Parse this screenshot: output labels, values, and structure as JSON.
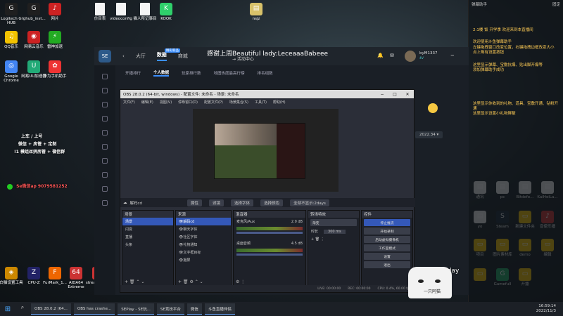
{
  "desktop": {
    "icons_left": [
      {
        "label": "Logitech G HUB",
        "color": "#1f1f1f",
        "glyph": "G"
      },
      {
        "label": "lghub_inst...",
        "color": "#1f1f1f",
        "glyph": "G"
      },
      {
        "label": "网片",
        "color": "#c22",
        "glyph": "♪"
      },
      {
        "label": "QQ音乐",
        "color": "#f2c200",
        "glyph": "♫"
      },
      {
        "label": "网易云音乐",
        "color": "#c22",
        "glyph": "◉"
      },
      {
        "label": "雷神加速",
        "color": "#2a2",
        "glyph": "⚡"
      },
      {
        "label": "Google Chrome",
        "color": "#4285f4",
        "glyph": "◎"
      },
      {
        "label": "网易UU加速器",
        "color": "#2a7",
        "glyph": "U"
      },
      {
        "label": "华为手机助手",
        "color": "#e33",
        "glyph": "✿"
      }
    ],
    "icons_top_files": [
      {
        "label": "价目表"
      },
      {
        "label": "videoconfig"
      },
      {
        "label": "猫人所记事目"
      }
    ],
    "icons_top_apps": [
      {
        "label": "KOOK",
        "color": "#2fd06b",
        "glyph": "K"
      },
      {
        "label": "nsjz",
        "color": "#d8c26a",
        "glyph": "▤"
      }
    ],
    "icons_bottom": [
      {
        "label": "白猫设置工具",
        "color": "#c80",
        "glyph": "◈"
      },
      {
        "label": "CPU-Z",
        "color": "#226",
        "glyph": "Z"
      },
      {
        "label": "FurMark_1...",
        "color": "#e60",
        "glyph": "F"
      },
      {
        "label": "AIDA64 Extreme",
        "color": "#c33",
        "glyph": "64"
      },
      {
        "label": "streamcom...",
        "color": "#c33",
        "glyph": "◆"
      }
    ],
    "icons_right": [
      {
        "label": "通讯",
        "color": "#eee",
        "glyph": "▤"
      },
      {
        "label": "pc",
        "color": "#eee",
        "glyph": "▤"
      },
      {
        "label": "Bitdefe...",
        "color": "#eee",
        "glyph": "▤"
      },
      {
        "label": "KaiHeiLa...",
        "color": "#eee",
        "glyph": "▤"
      },
      {
        "label": "yo",
        "color": "#eee",
        "glyph": "▤"
      },
      {
        "label": "Steam",
        "color": "#1b2838",
        "glyph": "S"
      },
      {
        "label": "新建文件夹",
        "color": "#f2c200",
        "glyph": "▭"
      },
      {
        "label": "音使乐播",
        "color": "#c33",
        "glyph": "♪"
      },
      {
        "label": "项目",
        "color": "#f2c200",
        "glyph": "▭"
      },
      {
        "label": "图片素材库",
        "color": "#f2c200",
        "glyph": "▭"
      },
      {
        "label": "demo",
        "color": "#f2c200",
        "glyph": "▭"
      },
      {
        "label": "编辑",
        "color": "#f2c200",
        "glyph": "▭"
      },
      {
        "label": "",
        "color": "#f2c200",
        "glyph": "▭"
      },
      {
        "label": "Gamefull",
        "color": "#2a6",
        "glyph": "G"
      },
      {
        "label": "开播",
        "color": "#f2c200",
        "glyph": "▭"
      }
    ]
  },
  "overlay": {
    "line1": "上车 / 上号",
    "line2": "微信 + 房管 + 定制",
    "line3": "!1 模组丝拼房管 + 微信群",
    "wechat": "Se微信ap 9079581252",
    "bottom_text": "坚毅不屈 ·day",
    "cat_text": "一只阿猫"
  },
  "site": {
    "logo": "SE",
    "nav": [
      "大厅",
      "数据",
      "商城"
    ],
    "nav_badge": "精彩新品",
    "ticker": "感谢上周Beautiful lady:LeceaaaBabeee",
    "ticker_prefix": "→ 活动中心",
    "subnav": [
      "开播排行",
      "个人数据",
      "玩家排行数",
      "地图热度最高行榜",
      "排名组数"
    ],
    "user_name": "byM1337",
    "user_level": "4V",
    "date_select": "2022.34"
  },
  "obs": {
    "title": "OBS 28.0.2 (64-bit, windows) - 配置文件: 未命名 - 场景: 未命名",
    "menu": [
      "文件(F)",
      "编辑(E)",
      "视图(V)",
      "停靠窗口(D)",
      "配置文件(P)",
      "场景集合(S)",
      "工具(T)",
      "帮助(H)"
    ],
    "source_label": "解码cd",
    "source_buttons": [
      "属性",
      "滤镜",
      "选择字体",
      "选择颜色",
      "全部不显示:2days"
    ],
    "docks": {
      "scenes": {
        "title": "场景",
        "items": [
          "场景",
          "闪变",
          "直播",
          "头条"
        ]
      },
      "sources": {
        "title": "来源",
        "items": [
          "解码cd",
          "聊天字体",
          "社区字体",
          "礼物通知",
          "文字框目标",
          "摄屏"
        ]
      },
      "mixer": {
        "title": "混音器",
        "tracks": [
          {
            "name": "麦克风/Aux",
            "db": "2.0 dB"
          },
          {
            "name": "桌面音频",
            "db": "4.5 dB"
          }
        ]
      },
      "transitions": {
        "title": "转场特效",
        "type": "渐变",
        "duration_label": "时长",
        "duration": "300 ms"
      },
      "controls": {
        "title": "控件",
        "buttons": [
          "停止推流",
          "开始录制",
          "启动虚拟摄像机",
          "工作室模式",
          "设置",
          "退出"
        ]
      }
    },
    "status": {
      "live": "LIVE: 00:00:00",
      "rec": "REC: 00:00:00",
      "cpu": "CPU: 0.4%, 60.00 fps"
    }
  },
  "chat": {
    "header_left": "弹幕助手",
    "header_right": "固定",
    "messages": [
      {
        "text": "2:1楼 饭 开学季 欢迎来到本直播间",
        "color": "yellow"
      },
      {
        "text": "欢迎使用斗鱼弹幕助手",
        "color": "yellow"
      },
      {
        "text": "左键拖拽窗口改变位置，右键拖拽边框改变大小",
        "color": "yellow"
      },
      {
        "text": "点上角有设置按钮",
        "color": "yellow"
      },
      {
        "text": "这里显示弹幕、宝敷抗爆、贴出脚开爆等",
        "color": "yellow"
      },
      {
        "text": "添加弹幕助手成功",
        "color": "yellow"
      },
      {
        "text": "这里显示你收到的礼物、道具、宝敷开通、钻粉开通",
        "color": "yellow"
      },
      {
        "text": "这里显示设置小礼物屏蔽",
        "color": "yellow"
      }
    ]
  },
  "taskbar": {
    "apps": [
      "OBS 28.0.2 (64...",
      "OBS has crashe...",
      "SEPlay - SE玩...",
      "SE竞技平台",
      "微信",
      "斗鱼直播伴侣"
    ],
    "time": "16:59:14",
    "date": "2022/11/3"
  }
}
